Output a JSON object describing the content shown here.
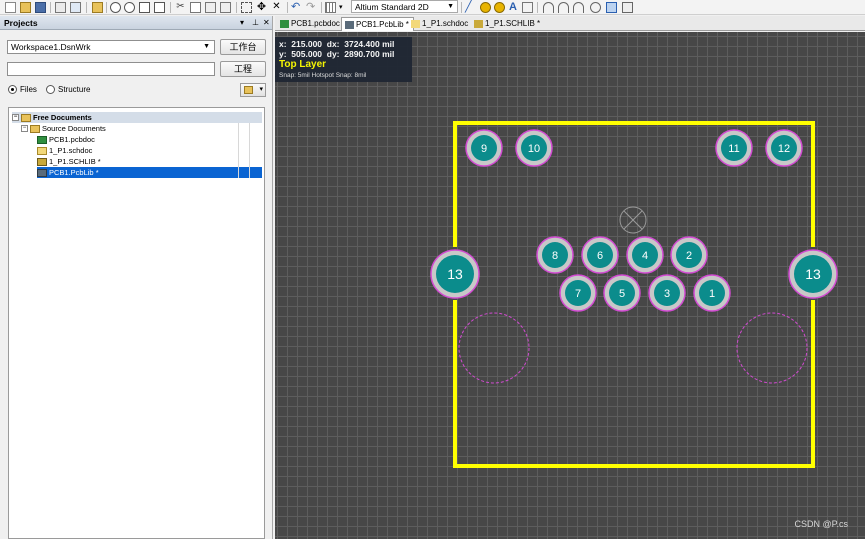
{
  "toolbar": {
    "view_mode": "Altium Standard 2D"
  },
  "projects": {
    "title": "Projects",
    "workspace": "Workspace1.DsnWrk",
    "workspace_button": "工作台",
    "project_button": "工程",
    "radio_files": "Files",
    "radio_structure": "Structure",
    "tree": {
      "root": "Free Documents",
      "group": "Source Documents",
      "items": [
        "PCB1.pcbdoc",
        "1_P1.schdoc",
        "1_P1.SCHLIB *",
        "PCB1.PcbLib *"
      ]
    }
  },
  "tabs": [
    {
      "label": "PCB1.pcbdoc",
      "icon": "pcb-doc-icon"
    },
    {
      "label": "PCB1.PcbLib *",
      "icon": "pcblib-icon"
    },
    {
      "label": "1_P1.schdoc",
      "icon": "schdoc-icon"
    },
    {
      "label": "1_P1.SCHLIB *",
      "icon": "schlib-icon"
    }
  ],
  "hud": {
    "x_label": "x:",
    "x": "215.000",
    "dx_label": "dx:",
    "dx": "3724.400 mil",
    "y_label": "y:",
    "y": "505.000",
    "dy_label": "dy:",
    "dy": "2890.700 mil",
    "layer": "Top Layer",
    "snap": "Snap: 5mil Hotspot Snap: 8mil"
  },
  "pads": [
    "9",
    "10",
    "11",
    "12",
    "13",
    "8",
    "6",
    "4",
    "2",
    "13",
    "7",
    "5",
    "3",
    "1"
  ],
  "watermark": "CSDN @P.cs",
  "colors": {
    "outline": "#ffff00",
    "pad": "#0b8c8c",
    "pad_ring": "#c8c8c8",
    "mech_hole": "#d24bd2",
    "selection": "#0a64d2"
  }
}
